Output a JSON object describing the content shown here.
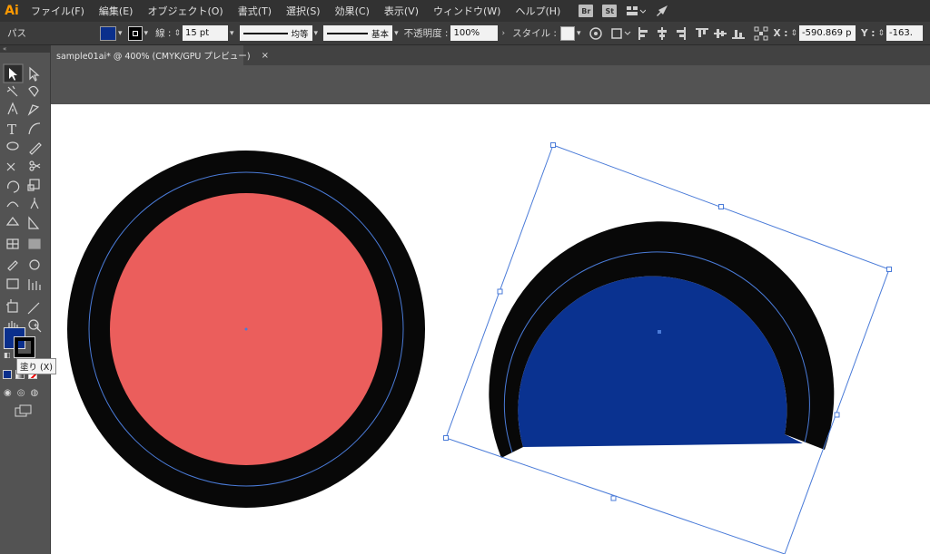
{
  "app": {
    "logo": "Ai"
  },
  "menubar": {
    "items": [
      "ファイル(F)",
      "編集(E)",
      "オブジェクト(O)",
      "書式(T)",
      "選択(S)",
      "効果(C)",
      "表示(V)",
      "ウィンドウ(W)",
      "ヘルプ(H)"
    ],
    "badges": [
      "Br",
      "St"
    ]
  },
  "control": {
    "object_type": "パス",
    "stroke_label": "線 :",
    "stroke_weight": "15 pt",
    "profile_label": "均等",
    "brush_label": "基本",
    "opacity_label": "不透明度 :",
    "opacity_value": "100%",
    "style_label": "スタイル :",
    "x_label": "X :",
    "x_value": "-590.869 p",
    "y_label": "Y :",
    "y_value": "-163.",
    "fill_color": "#0a2f8c"
  },
  "document": {
    "tab_title": "sample01ai* @ 400% (CMYK/GPU プレビュー)",
    "close_glyph": "×"
  },
  "tooltip": {
    "text": "塗り (X)"
  },
  "colors": {
    "circle_fill": "#eb5e5c",
    "semi_fill": "#0a3290",
    "ring": "#080808",
    "guide": "#4a7bd8"
  }
}
